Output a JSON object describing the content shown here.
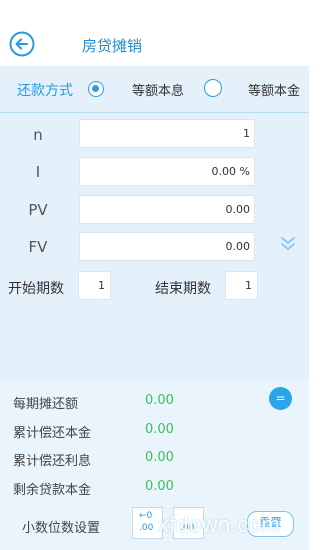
{
  "header": {
    "title": "房贷摊销",
    "back_icon": "arrow-left-circle-icon"
  },
  "mode": {
    "label": "还款方式",
    "options": [
      {
        "label": "等额本息",
        "selected": true
      },
      {
        "label": "等额本金",
        "selected": false
      }
    ]
  },
  "inputs": [
    {
      "label": "n",
      "value": "1"
    },
    {
      "label": "I",
      "value": "0.00 %"
    },
    {
      "label": "PV",
      "value": "0.00"
    },
    {
      "label": "FV",
      "value": "0.00"
    }
  ],
  "periods": {
    "start_label": "开始期数",
    "start_value": "1",
    "end_label": "结束期数",
    "end_value": "1"
  },
  "results": [
    {
      "label": "每期摊还额",
      "value": "0.00"
    },
    {
      "label": "累计偿还本金",
      "value": "0.00"
    },
    {
      "label": "累计偿还利息",
      "value": "0.00"
    },
    {
      "label": "剩余贷款本金",
      "value": "0.00"
    }
  ],
  "equals_label": "=",
  "decimal": {
    "label": "小数位数设置",
    "decrease_top": "←0",
    "decrease_bottom": ".00",
    "increase_top": "",
    "increase_bottom": ".00",
    "action_label": "重置"
  },
  "watermark": "xfdown.com",
  "colors": {
    "accent": "#2a9be0",
    "panel_bg": "#e4f1fb",
    "result_value": "#3cbf5a"
  }
}
